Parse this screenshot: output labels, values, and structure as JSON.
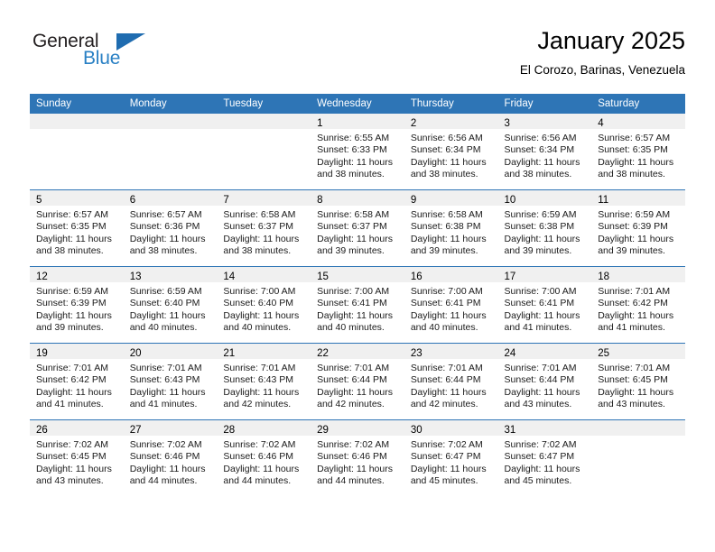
{
  "brand": {
    "name_part1": "General",
    "name_part2": "Blue",
    "triangle_icon": "blue-triangle-icon",
    "colors": {
      "dark": "#231f20",
      "blue": "#2980c4",
      "triangle": "#1f6cb0"
    }
  },
  "header": {
    "title": "January 2025",
    "subtitle": "El Corozo, Barinas, Venezuela"
  },
  "calendar": {
    "header_background": "#2e75b6",
    "daynum_background": "#f0f0f0",
    "weekday_headers": [
      "Sunday",
      "Monday",
      "Tuesday",
      "Wednesday",
      "Thursday",
      "Friday",
      "Saturday"
    ],
    "weeks": [
      [
        {
          "day": "",
          "lines": []
        },
        {
          "day": "",
          "lines": []
        },
        {
          "day": "",
          "lines": []
        },
        {
          "day": "1",
          "lines": [
            "Sunrise: 6:55 AM",
            "Sunset: 6:33 PM",
            "Daylight: 11 hours",
            "and 38 minutes."
          ]
        },
        {
          "day": "2",
          "lines": [
            "Sunrise: 6:56 AM",
            "Sunset: 6:34 PM",
            "Daylight: 11 hours",
            "and 38 minutes."
          ]
        },
        {
          "day": "3",
          "lines": [
            "Sunrise: 6:56 AM",
            "Sunset: 6:34 PM",
            "Daylight: 11 hours",
            "and 38 minutes."
          ]
        },
        {
          "day": "4",
          "lines": [
            "Sunrise: 6:57 AM",
            "Sunset: 6:35 PM",
            "Daylight: 11 hours",
            "and 38 minutes."
          ]
        }
      ],
      [
        {
          "day": "5",
          "lines": [
            "Sunrise: 6:57 AM",
            "Sunset: 6:35 PM",
            "Daylight: 11 hours",
            "and 38 minutes."
          ]
        },
        {
          "day": "6",
          "lines": [
            "Sunrise: 6:57 AM",
            "Sunset: 6:36 PM",
            "Daylight: 11 hours",
            "and 38 minutes."
          ]
        },
        {
          "day": "7",
          "lines": [
            "Sunrise: 6:58 AM",
            "Sunset: 6:37 PM",
            "Daylight: 11 hours",
            "and 38 minutes."
          ]
        },
        {
          "day": "8",
          "lines": [
            "Sunrise: 6:58 AM",
            "Sunset: 6:37 PM",
            "Daylight: 11 hours",
            "and 39 minutes."
          ]
        },
        {
          "day": "9",
          "lines": [
            "Sunrise: 6:58 AM",
            "Sunset: 6:38 PM",
            "Daylight: 11 hours",
            "and 39 minutes."
          ]
        },
        {
          "day": "10",
          "lines": [
            "Sunrise: 6:59 AM",
            "Sunset: 6:38 PM",
            "Daylight: 11 hours",
            "and 39 minutes."
          ]
        },
        {
          "day": "11",
          "lines": [
            "Sunrise: 6:59 AM",
            "Sunset: 6:39 PM",
            "Daylight: 11 hours",
            "and 39 minutes."
          ]
        }
      ],
      [
        {
          "day": "12",
          "lines": [
            "Sunrise: 6:59 AM",
            "Sunset: 6:39 PM",
            "Daylight: 11 hours",
            "and 39 minutes."
          ]
        },
        {
          "day": "13",
          "lines": [
            "Sunrise: 6:59 AM",
            "Sunset: 6:40 PM",
            "Daylight: 11 hours",
            "and 40 minutes."
          ]
        },
        {
          "day": "14",
          "lines": [
            "Sunrise: 7:00 AM",
            "Sunset: 6:40 PM",
            "Daylight: 11 hours",
            "and 40 minutes."
          ]
        },
        {
          "day": "15",
          "lines": [
            "Sunrise: 7:00 AM",
            "Sunset: 6:41 PM",
            "Daylight: 11 hours",
            "and 40 minutes."
          ]
        },
        {
          "day": "16",
          "lines": [
            "Sunrise: 7:00 AM",
            "Sunset: 6:41 PM",
            "Daylight: 11 hours",
            "and 40 minutes."
          ]
        },
        {
          "day": "17",
          "lines": [
            "Sunrise: 7:00 AM",
            "Sunset: 6:41 PM",
            "Daylight: 11 hours",
            "and 41 minutes."
          ]
        },
        {
          "day": "18",
          "lines": [
            "Sunrise: 7:01 AM",
            "Sunset: 6:42 PM",
            "Daylight: 11 hours",
            "and 41 minutes."
          ]
        }
      ],
      [
        {
          "day": "19",
          "lines": [
            "Sunrise: 7:01 AM",
            "Sunset: 6:42 PM",
            "Daylight: 11 hours",
            "and 41 minutes."
          ]
        },
        {
          "day": "20",
          "lines": [
            "Sunrise: 7:01 AM",
            "Sunset: 6:43 PM",
            "Daylight: 11 hours",
            "and 41 minutes."
          ]
        },
        {
          "day": "21",
          "lines": [
            "Sunrise: 7:01 AM",
            "Sunset: 6:43 PM",
            "Daylight: 11 hours",
            "and 42 minutes."
          ]
        },
        {
          "day": "22",
          "lines": [
            "Sunrise: 7:01 AM",
            "Sunset: 6:44 PM",
            "Daylight: 11 hours",
            "and 42 minutes."
          ]
        },
        {
          "day": "23",
          "lines": [
            "Sunrise: 7:01 AM",
            "Sunset: 6:44 PM",
            "Daylight: 11 hours",
            "and 42 minutes."
          ]
        },
        {
          "day": "24",
          "lines": [
            "Sunrise: 7:01 AM",
            "Sunset: 6:44 PM",
            "Daylight: 11 hours",
            "and 43 minutes."
          ]
        },
        {
          "day": "25",
          "lines": [
            "Sunrise: 7:01 AM",
            "Sunset: 6:45 PM",
            "Daylight: 11 hours",
            "and 43 minutes."
          ]
        }
      ],
      [
        {
          "day": "26",
          "lines": [
            "Sunrise: 7:02 AM",
            "Sunset: 6:45 PM",
            "Daylight: 11 hours",
            "and 43 minutes."
          ]
        },
        {
          "day": "27",
          "lines": [
            "Sunrise: 7:02 AM",
            "Sunset: 6:46 PM",
            "Daylight: 11 hours",
            "and 44 minutes."
          ]
        },
        {
          "day": "28",
          "lines": [
            "Sunrise: 7:02 AM",
            "Sunset: 6:46 PM",
            "Daylight: 11 hours",
            "and 44 minutes."
          ]
        },
        {
          "day": "29",
          "lines": [
            "Sunrise: 7:02 AM",
            "Sunset: 6:46 PM",
            "Daylight: 11 hours",
            "and 44 minutes."
          ]
        },
        {
          "day": "30",
          "lines": [
            "Sunrise: 7:02 AM",
            "Sunset: 6:47 PM",
            "Daylight: 11 hours",
            "and 45 minutes."
          ]
        },
        {
          "day": "31",
          "lines": [
            "Sunrise: 7:02 AM",
            "Sunset: 6:47 PM",
            "Daylight: 11 hours",
            "and 45 minutes."
          ]
        },
        {
          "day": "",
          "lines": []
        }
      ]
    ]
  }
}
